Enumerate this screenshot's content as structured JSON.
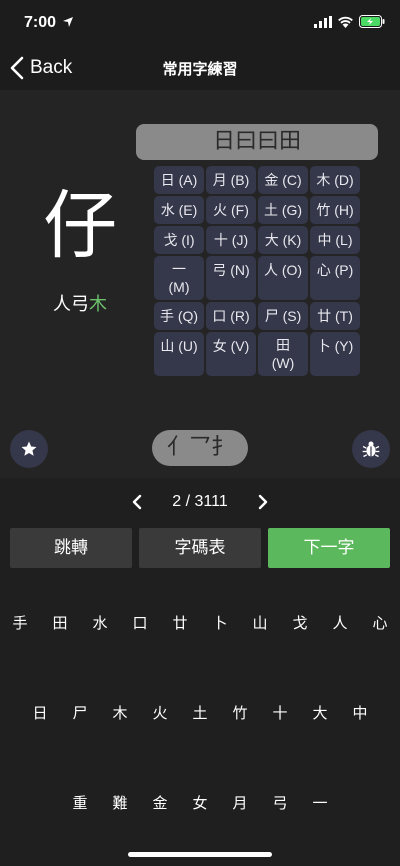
{
  "status": {
    "time": "7:00"
  },
  "nav": {
    "back_label": "Back",
    "title": "常用字練習"
  },
  "current_char": "仔",
  "components": {
    "normal": "人弓",
    "highlight": "木"
  },
  "root_display": "日曰曰田",
  "keys": [
    [
      "日 (A)"
    ],
    [
      "月 (B)"
    ],
    [
      "金 (C)"
    ],
    [
      "木 (D)"
    ],
    [
      "水 (E)"
    ],
    [
      "火 (F)"
    ],
    [
      "土 (G)"
    ],
    [
      "竹 (H)"
    ],
    [
      "戈 (I)"
    ],
    [
      "十 (J)"
    ],
    [
      "大 (K)"
    ],
    [
      "中 (L)"
    ],
    [
      "一",
      "(M)"
    ],
    [
      "弓 (N)"
    ],
    [
      "人 (O)"
    ],
    [
      "心 (P)"
    ],
    [
      "手 (Q)"
    ],
    [
      "口 (R)"
    ],
    [
      "尸 (S)"
    ],
    [
      "廿 (T)"
    ],
    [
      "山 (U)"
    ],
    [
      "女 (V)"
    ],
    [
      "田",
      "(W)"
    ],
    [
      "卜 (Y)"
    ]
  ],
  "input_display": "亻乛扌",
  "pager": {
    "text": "2 / 3111"
  },
  "actions": {
    "jump": "跳轉",
    "table": "字碼表",
    "next": "下一字"
  },
  "radical_rows": [
    [
      "手",
      "田",
      "水",
      "口",
      "廿",
      "卜",
      "山",
      "戈",
      "人",
      "心"
    ],
    [
      "日",
      "尸",
      "木",
      "火",
      "土",
      "竹",
      "十",
      "大",
      "中"
    ],
    [
      "重",
      "難",
      "金",
      "女",
      "月",
      "弓",
      "一"
    ]
  ],
  "colors": {
    "accent_green": "#5cb85c",
    "key_bg": "#35374a"
  }
}
